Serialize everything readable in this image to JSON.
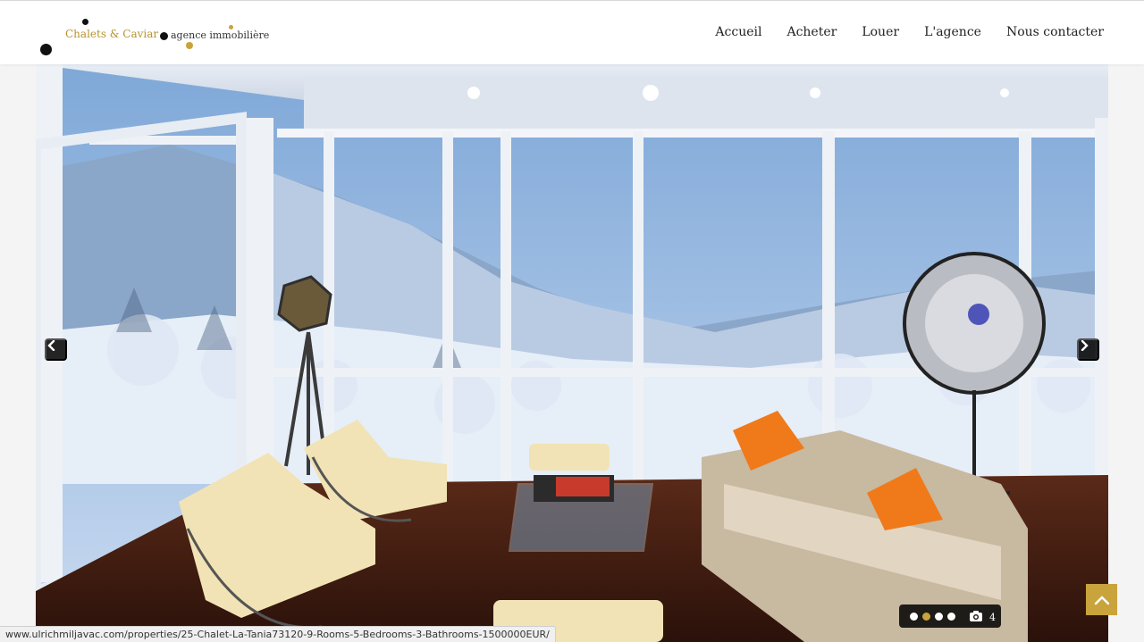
{
  "logo": {
    "brand": "Chalets & Caviar",
    "tagline": "agence immobilière"
  },
  "nav": {
    "items": [
      "Accueil",
      "Acheter",
      "Louer",
      "L'agence",
      "Nous contacter"
    ]
  },
  "slider": {
    "photo_count": "4",
    "total_slides": 4,
    "active_slide": 2
  },
  "status_bar": {
    "url": "www.ulrichmiljavac.com/properties/25-Chalet-La-Tania73120-9-Rooms-5-Bedrooms-3-Bathrooms-1500000EUR/"
  },
  "colors": {
    "accent_gold": "#c9a33b",
    "header_bg": "#ffffff"
  },
  "icons": [
    "chevron-left-icon",
    "chevron-right-icon",
    "camera-icon",
    "chevron-up-icon"
  ]
}
